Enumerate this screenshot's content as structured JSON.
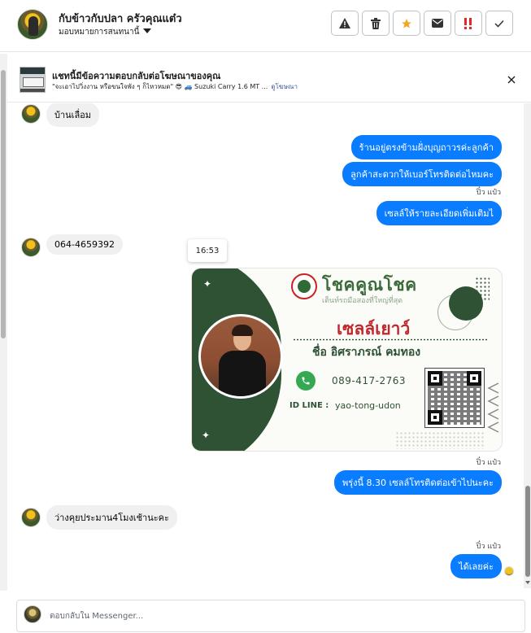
{
  "header": {
    "title": "กับข้าวกับปลา ครัวคุณแต๋ว",
    "subtitle": "มอบหมายการสนทนานี้",
    "actions": [
      {
        "name": "report-icon"
      },
      {
        "name": "trash-icon"
      },
      {
        "name": "star-icon"
      },
      {
        "name": "mail-icon"
      },
      {
        "name": "urgent-icon"
      },
      {
        "name": "check-icon"
      }
    ]
  },
  "ad": {
    "title": "แชทนี้มีข้อความตอบกลับต่อโฆษณาของคุณ",
    "text": "\"จะเอาไปวิ่งงาน หรือขนใจพัง ๆ ก็ไหวหมด\" 😎 🚙 Suzuki Carry 1.6 MT ...",
    "link": "ดูโฆษณา"
  },
  "messages": {
    "m1": "บ้านเลื่อม",
    "m2": "ร้านอยู่ตรงข้ามฝั่งบุญถาวรค่ะลูกค้า",
    "m3": "ลูกค้าสะดวกให้เบอร์โทรติดต่อไหมคะ",
    "seen1": "ปิ๋ว แป๋ว",
    "m4": "เซลล์ให้รายละเอียดเพิ่มเติมไ",
    "m5": "064-4659392",
    "time": "16:53",
    "seen2": "ปิ๋ว แป๋ว",
    "m6": "พรุ่งนี้ 8.30 เซลล์โทรติดต่อเข้าไปนะคะ",
    "m7": "ว่างคุยประมาน4โมงเช้านะคะ",
    "seen3": "ปิ๋ว แป๋ว",
    "m8": "ได้เลยค่ะ"
  },
  "card": {
    "brand": "โชคคูณโชค",
    "tagline": "เต็นท์รถมือสองที่ใหญ่ที่สุด",
    "nickname": "เซลล์เยาว์",
    "name": "ชื่อ อิศราภรณ์  คมทอง",
    "phone": "089-417-2763",
    "line_label": "ID LINE :",
    "line_id": "yao-tong-udon",
    "colors": {
      "green": "#2f5134",
      "red": "#c1272d"
    }
  },
  "composer": {
    "placeholder": "ตอบกลับใน Messenger..."
  },
  "colors": {
    "outgoing_bubble": "#0a7cff",
    "incoming_bubble": "#f0f0f0",
    "accent_star": "#f5a623",
    "urgent": "#e02828"
  }
}
